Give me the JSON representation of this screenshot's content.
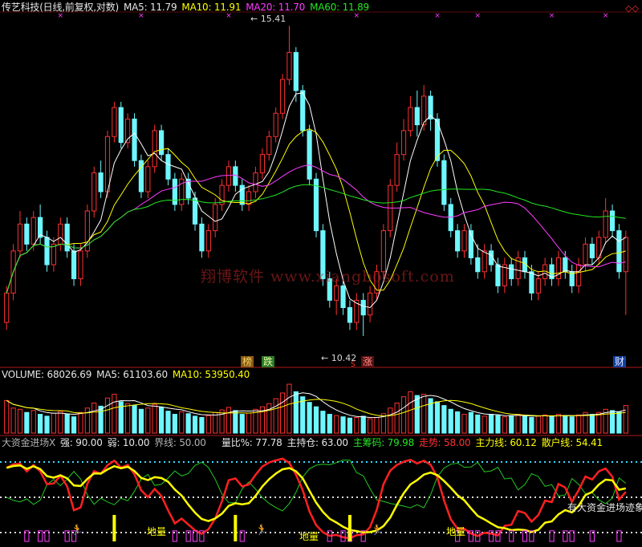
{
  "header": {
    "stock": "传艺科技(日线,前复权,对数)",
    "ma5": "MA5: 11.79",
    "ma10": "MA10: 11.91",
    "ma20": "MA20: 11.70",
    "ma60": "MA60: 11.89"
  },
  "volume_header": {
    "volume": "VOLUME: 68026.69",
    "ma5": "MA5: 61103.60",
    "ma10": "MA10: 53950.40"
  },
  "indicator_header": {
    "name": "大资金进场X",
    "strong": "强: 90.00",
    "weak": "弱: 10.00",
    "boundary": "界线: 50.00",
    "ratio": "量比%: 77.78",
    "holding": "主持仓: 63.00",
    "chips": "主筹码: 79.98",
    "trend": "走势: 58.00",
    "main_line": "主力线: 60.12",
    "retail_line": "散户线: 54.41"
  },
  "annotations": {
    "high_label": "15.41",
    "low_label": "10.42",
    "watermark": "翔博软件 www.xiangbosoft.com",
    "tag_bang": "榜",
    "tag_die": "跌",
    "tag_s": "S",
    "tag_zhang": "涨",
    "tag_cai": "财",
    "callout": "有大资金进场迹象",
    "star_label": "地量",
    "runner_icon": "runner-icon"
  },
  "colors": {
    "up": "#ff3030",
    "down": "#6ef7ff",
    "ma5": "#ffffff",
    "ma10": "#ffff00",
    "ma20": "#ff3cff",
    "ma60": "#22e822"
  },
  "chart_data": [
    {
      "type": "candlestick",
      "title": "传艺科技(日线,前复权,对数)",
      "y_scale": "log",
      "ylim": [
        10.2,
        15.6
      ],
      "high_marker": 15.41,
      "low_marker": 10.42,
      "candles": [
        [
          10.6,
          11.0,
          10.5,
          11.1
        ],
        [
          11.0,
          11.6,
          10.9,
          11.7
        ],
        [
          11.6,
          12.0,
          11.5,
          12.2
        ],
        [
          12.0,
          11.7,
          11.6,
          12.1
        ],
        [
          11.7,
          12.1,
          11.6,
          12.2
        ],
        [
          12.1,
          11.8,
          11.7,
          12.3
        ],
        [
          11.8,
          11.4,
          11.3,
          11.9
        ],
        [
          11.4,
          11.7,
          11.3,
          11.8
        ],
        [
          11.7,
          12.0,
          11.6,
          12.1
        ],
        [
          12.0,
          11.6,
          11.5,
          12.1
        ],
        [
          11.6,
          11.2,
          11.1,
          11.7
        ],
        [
          11.2,
          11.6,
          11.1,
          11.7
        ],
        [
          11.6,
          12.2,
          11.5,
          12.3
        ],
        [
          12.2,
          12.8,
          12.1,
          12.9
        ],
        [
          12.8,
          12.5,
          12.4,
          13.0
        ],
        [
          12.5,
          13.4,
          12.4,
          13.5
        ],
        [
          13.4,
          13.9,
          13.3,
          14.0
        ],
        [
          13.9,
          13.3,
          13.2,
          14.0
        ],
        [
          13.3,
          13.7,
          13.2,
          13.8
        ],
        [
          13.7,
          13.0,
          12.9,
          13.8
        ],
        [
          13.0,
          12.5,
          12.4,
          13.1
        ],
        [
          12.5,
          12.9,
          12.4,
          13.0
        ],
        [
          12.9,
          13.5,
          12.8,
          13.6
        ],
        [
          13.5,
          13.1,
          13.0,
          13.6
        ],
        [
          13.1,
          12.7,
          12.6,
          13.2
        ],
        [
          12.7,
          12.3,
          12.2,
          12.8
        ],
        [
          12.3,
          12.7,
          12.2,
          12.8
        ],
        [
          12.7,
          12.4,
          12.3,
          12.8
        ],
        [
          12.4,
          12.0,
          11.9,
          12.5
        ],
        [
          12.0,
          11.6,
          11.5,
          12.1
        ],
        [
          11.6,
          11.9,
          11.5,
          12.0
        ],
        [
          11.9,
          12.3,
          11.8,
          12.4
        ],
        [
          12.3,
          12.6,
          12.2,
          12.7
        ],
        [
          12.6,
          12.9,
          12.5,
          13.0
        ],
        [
          12.9,
          12.6,
          12.5,
          13.0
        ],
        [
          12.6,
          12.3,
          12.2,
          12.7
        ],
        [
          12.3,
          12.5,
          12.2,
          12.6
        ],
        [
          12.5,
          12.8,
          12.4,
          12.9
        ],
        [
          12.8,
          13.1,
          12.7,
          13.2
        ],
        [
          13.1,
          13.4,
          13.0,
          13.5
        ],
        [
          13.4,
          13.8,
          13.3,
          13.9
        ],
        [
          13.8,
          14.4,
          13.7,
          14.5
        ],
        [
          14.4,
          14.9,
          14.3,
          15.41
        ],
        [
          14.9,
          14.2,
          14.0,
          15.0
        ],
        [
          14.2,
          13.5,
          13.4,
          14.3
        ],
        [
          13.5,
          12.7,
          12.6,
          13.6
        ],
        [
          12.7,
          11.9,
          11.8,
          12.8
        ],
        [
          11.9,
          11.2,
          11.1,
          12.0
        ],
        [
          11.2,
          10.9,
          10.8,
          11.3
        ],
        [
          10.9,
          11.1,
          10.7,
          11.2
        ],
        [
          11.1,
          10.8,
          10.7,
          11.2
        ],
        [
          10.8,
          10.6,
          10.5,
          10.9
        ],
        [
          10.6,
          10.9,
          10.5,
          11.0
        ],
        [
          10.9,
          10.7,
          10.42,
          11.0
        ],
        [
          10.7,
          11.0,
          10.6,
          11.1
        ],
        [
          11.0,
          11.3,
          10.9,
          11.4
        ],
        [
          11.3,
          11.9,
          11.2,
          12.0
        ],
        [
          11.9,
          12.6,
          11.8,
          12.7
        ],
        [
          12.6,
          13.1,
          12.5,
          13.3
        ],
        [
          13.1,
          13.5,
          13.0,
          13.7
        ],
        [
          13.5,
          13.9,
          13.4,
          14.1
        ],
        [
          13.9,
          13.6,
          13.4,
          14.2
        ],
        [
          13.6,
          14.1,
          13.5,
          14.3
        ],
        [
          14.1,
          13.7,
          13.5,
          14.2
        ],
        [
          13.7,
          13.0,
          12.9,
          13.8
        ],
        [
          13.0,
          12.3,
          12.2,
          13.1
        ],
        [
          12.3,
          11.9,
          11.8,
          12.4
        ],
        [
          11.9,
          11.6,
          11.5,
          12.0
        ],
        [
          11.6,
          11.9,
          11.5,
          12.0
        ],
        [
          11.9,
          11.5,
          11.4,
          12.0
        ],
        [
          11.5,
          11.3,
          11.2,
          11.7
        ],
        [
          11.3,
          11.6,
          11.2,
          11.7
        ],
        [
          11.6,
          11.4,
          11.3,
          11.7
        ],
        [
          11.4,
          11.1,
          11.0,
          11.5
        ],
        [
          11.1,
          11.4,
          11.0,
          11.5
        ],
        [
          11.4,
          11.2,
          11.1,
          11.5
        ],
        [
          11.2,
          11.5,
          11.1,
          11.6
        ],
        [
          11.5,
          11.3,
          11.2,
          11.6
        ],
        [
          11.3,
          11.0,
          10.9,
          11.4
        ],
        [
          11.0,
          11.2,
          10.9,
          11.3
        ],
        [
          11.2,
          11.4,
          11.1,
          11.5
        ],
        [
          11.4,
          11.2,
          11.1,
          11.5
        ],
        [
          11.2,
          11.5,
          11.1,
          11.6
        ],
        [
          11.5,
          11.3,
          11.2,
          11.6
        ],
        [
          11.3,
          11.1,
          11.0,
          11.4
        ],
        [
          11.1,
          11.4,
          11.0,
          11.5
        ],
        [
          11.4,
          11.7,
          11.3,
          11.8
        ],
        [
          11.7,
          11.5,
          11.4,
          11.8
        ],
        [
          11.5,
          11.8,
          11.4,
          11.9
        ],
        [
          11.8,
          12.2,
          11.7,
          12.4
        ],
        [
          12.2,
          11.9,
          11.8,
          12.3
        ],
        [
          11.9,
          11.3,
          11.2,
          12.0
        ],
        [
          11.3,
          11.8,
          10.7,
          11.9
        ]
      ]
    },
    {
      "type": "bar",
      "title": "VOLUME",
      "values": [
        52,
        40,
        38,
        33,
        36,
        30,
        27,
        32,
        35,
        30,
        26,
        33,
        40,
        48,
        43,
        56,
        62,
        50,
        47,
        44,
        38,
        40,
        46,
        41,
        35,
        30,
        34,
        31,
        27,
        25,
        28,
        33,
        37,
        41,
        36,
        30,
        32,
        38,
        42,
        47,
        55,
        64,
        78,
        66,
        58,
        49,
        42,
        35,
        30,
        28,
        26,
        24,
        25,
        27,
        23,
        25,
        31,
        40,
        48,
        58,
        66,
        60,
        62,
        55,
        50,
        44,
        38,
        34,
        30,
        33,
        29,
        27,
        30,
        28,
        26,
        28,
        30,
        27,
        25,
        27,
        29,
        27,
        30,
        28,
        26,
        29,
        33,
        30,
        33,
        38,
        36,
        34,
        44
      ]
    },
    {
      "type": "line",
      "title": "大资金进场X",
      "ylim": [
        0,
        100
      ],
      "levels": {
        "strong": 90,
        "weak": 10,
        "boundary": 50
      }
    }
  ]
}
